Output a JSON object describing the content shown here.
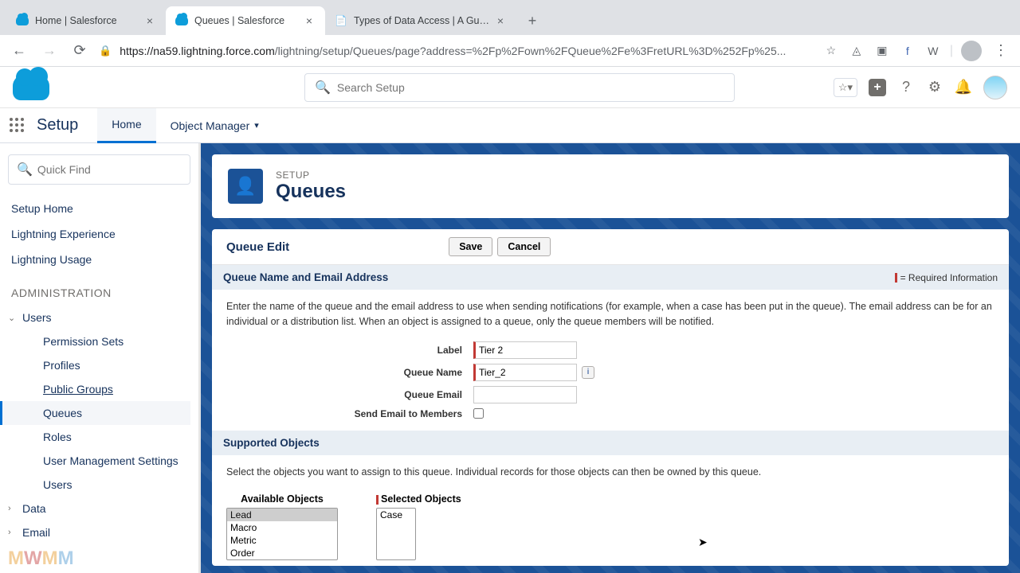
{
  "browser": {
    "tabs": [
      {
        "title": "Home | Salesforce",
        "active": false
      },
      {
        "title": "Queues | Salesforce",
        "active": true
      },
      {
        "title": "Types of Data Access | A Guid…",
        "active": false
      }
    ],
    "url_domain": "https://na59.lightning.force.com",
    "url_path": "/lightning/setup/Queues/page?address=%2Fp%2Fown%2FQueue%2Fe%3FretURL%3D%252Fp%25..."
  },
  "header": {
    "search_placeholder": "Search Setup"
  },
  "nav": {
    "setup": "Setup",
    "home": "Home",
    "object_manager": "Object Manager"
  },
  "sidebar": {
    "quick_find": "Quick Find",
    "links": [
      "Setup Home",
      "Lightning Experience",
      "Lightning Usage"
    ],
    "admin_heading": "ADMINISTRATION",
    "users_label": "Users",
    "users_children": [
      "Permission Sets",
      "Profiles",
      "Public Groups",
      "Queues",
      "Roles",
      "User Management Settings",
      "Users"
    ],
    "data_label": "Data",
    "email_label": "Email"
  },
  "page": {
    "crumb": "SETUP",
    "title": "Queues"
  },
  "form": {
    "title": "Queue Edit",
    "save": "Save",
    "cancel": "Cancel",
    "section1": "Queue Name and Email Address",
    "required_info": "= Required Information",
    "help1": "Enter the name of the queue and the email address to use when sending notifications (for example, when a case has been put in the queue). The email address can be for an individual or a distribution list. When an object is assigned to a queue, only the queue members will be notified.",
    "label_label": "Label",
    "label_value": "Tier 2",
    "qname_label": "Queue Name",
    "qname_value": "Tier_2",
    "qemail_label": "Queue Email",
    "qemail_value": "",
    "send_email_label": "Send Email to Members",
    "section2": "Supported Objects",
    "help2": "Select the objects you want to assign to this queue. Individual records for those objects can then be owned by this queue.",
    "available_title": "Available Objects",
    "available_options": [
      "Lead",
      "Macro",
      "Metric",
      "Order"
    ],
    "selected_title": "Selected Objects",
    "selected_options": [
      "Case"
    ]
  }
}
